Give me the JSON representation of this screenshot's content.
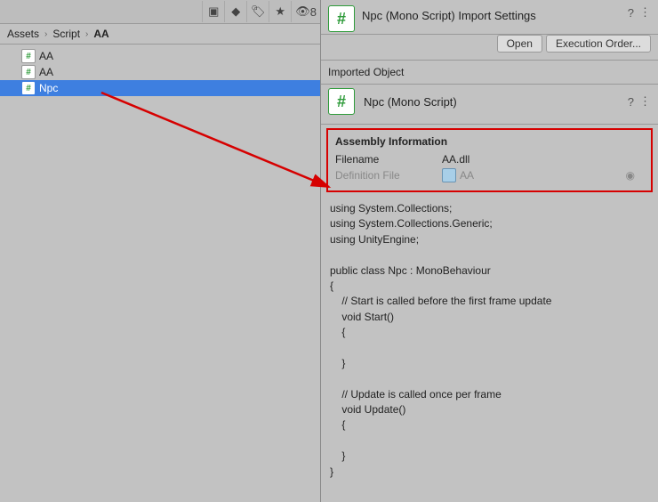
{
  "left_toolbar": {
    "count_label": "8"
  },
  "breadcrumb": {
    "root": "Assets",
    "mid": "Script",
    "leaf": "AA"
  },
  "tree": {
    "items": [
      {
        "icon": "#",
        "label": "AA"
      },
      {
        "icon": "#",
        "label": "AA"
      },
      {
        "icon": "#",
        "label": "Npc"
      }
    ]
  },
  "inspector": {
    "header": {
      "icon": "#",
      "title": "Npc (Mono Script) Import Settings"
    },
    "buttons": {
      "open": "Open",
      "exec_order": "Execution Order..."
    },
    "imported_label": "Imported Object",
    "object": {
      "icon": "#",
      "title": "Npc (Mono Script)"
    },
    "assembly": {
      "heading": "Assembly Information",
      "filename_label": "Filename",
      "filename_value": "AA.dll",
      "deffile_label": "Definition File",
      "deffile_value": "AA"
    },
    "code": "using System.Collections;\nusing System.Collections.Generic;\nusing UnityEngine;\n\npublic class Npc : MonoBehaviour\n{\n    // Start is called before the first frame update\n    void Start()\n    {\n        \n    }\n\n    // Update is called once per frame\n    void Update()\n    {\n        \n    }\n}"
  }
}
